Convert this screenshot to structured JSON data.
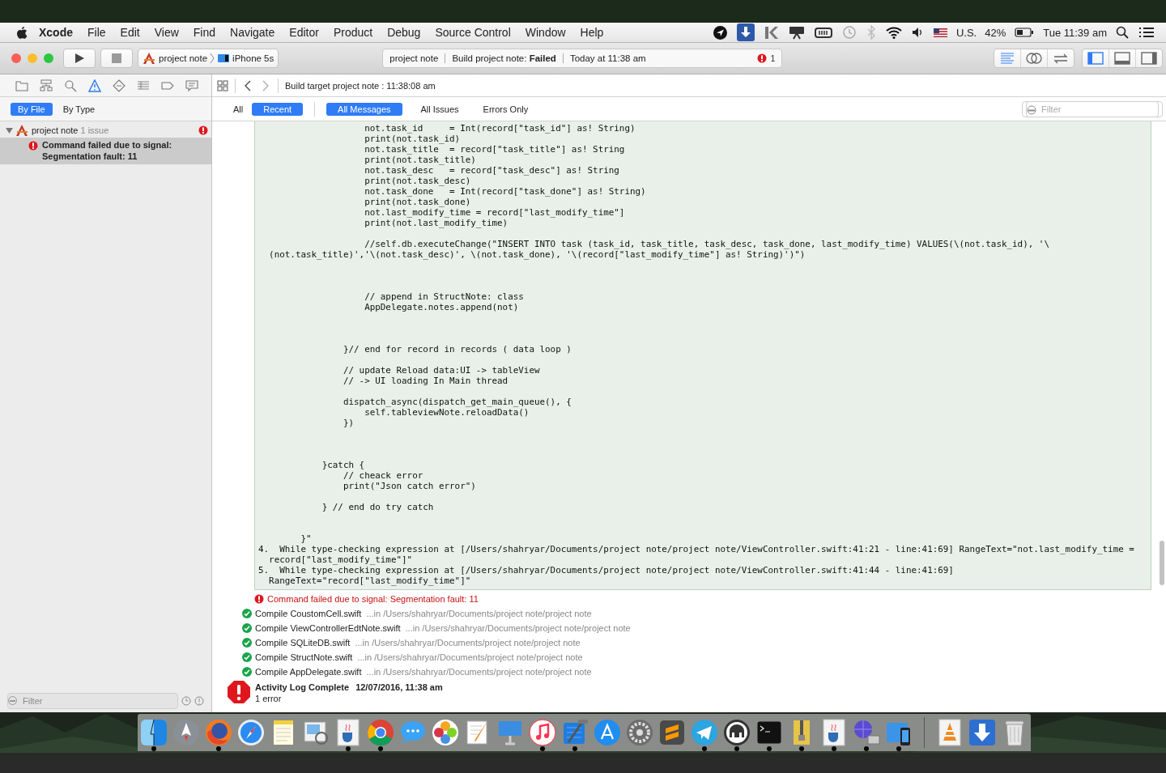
{
  "menu_bar": {
    "app_name": "Xcode",
    "items": [
      "File",
      "Edit",
      "View",
      "Find",
      "Navigate",
      "Editor",
      "Product",
      "Debug",
      "Source Control",
      "Window",
      "Help"
    ],
    "input_source": "U.S.",
    "battery": "42%",
    "clock": "Tue 11:39 am"
  },
  "toolbar": {
    "scheme": {
      "project": "project note",
      "device": "iPhone 5s"
    },
    "activity": {
      "project": "project note",
      "status": "Build project note: **Failed**",
      "time": "Today at 11:38 am",
      "error_count": "1"
    },
    "editor_modes": [
      {
        "kind": "standard",
        "selected": true
      },
      {
        "kind": "assistant",
        "selected": false
      },
      {
        "kind": "version",
        "selected": false
      }
    ],
    "panels": [
      {
        "kind": "navigator",
        "selected": true
      },
      {
        "kind": "debug",
        "selected": false
      },
      {
        "kind": "utilities",
        "selected": false
      }
    ]
  },
  "navigator": {
    "tabs": [
      {
        "kind": "folder",
        "selected": false
      },
      {
        "kind": "hierarchy",
        "selected": false
      },
      {
        "kind": "search",
        "selected": false
      },
      {
        "kind": "issue",
        "selected": true
      },
      {
        "kind": "test",
        "selected": false
      },
      {
        "kind": "debug",
        "selected": false
      },
      {
        "kind": "breakpoint",
        "selected": false
      },
      {
        "kind": "report",
        "selected": false
      }
    ],
    "scope_tabs": [
      {
        "label": "By File",
        "selected": true
      },
      {
        "label": "By Type",
        "selected": false
      }
    ],
    "tree": [
      {
        "label": "project note",
        "count": "1 issue",
        "error": true,
        "expanded": true,
        "children": [
          {
            "label": "Command failed due to signal: Segmentation fault: 11",
            "error": true,
            "selected": true
          }
        ]
      }
    ],
    "filter": {
      "placeholder": "Filter"
    }
  },
  "log": {
    "breadcrumb": "Build target project note : 11:38:08 am",
    "scopes": [
      {
        "label": "All",
        "selected": false
      },
      {
        "label": "Recent",
        "selected": true
      }
    ],
    "filters": [
      {
        "label": "All Messages",
        "selected": true
      },
      {
        "label": "All Issues",
        "selected": false
      },
      {
        "label": "Errors Only",
        "selected": false
      }
    ],
    "filter_placeholder": "Filter",
    "code": "                    not.task_id     = Int(record[\"task_id\"] as! String)\n                    print(not.task_id)\n                    not.task_title  = record[\"task_title\"] as! String\n                    print(not.task_title)\n                    not.task_desc   = record[\"task_desc\"] as! String\n                    print(not.task_desc)\n                    not.task_done   = Int(record[\"task_done\"] as! String)\n                    print(not.task_done)\n                    not.last_modify_time = record[\"last_modify_time\"]\n                    print(not.last_modify_time)\n\n                    //self.db.executeChange(\"INSERT INTO task (task_id, task_title, task_desc, task_done, last_modify_time) VALUES(\\(not.task_id), '\\\n  (not.task_title)','\\(not.task_desc)', \\(not.task_done), '\\(record[\"last_modify_time\"] as! String)')\")\n\n\n\n                    // append in StructNote: class\n                    AppDelegate.notes.append(not)\n\n\n\n                }// end for record in records ( data loop )\n\n                // update Reload data:UI -> tableView\n                // -> UI loading In Main thread\n\n                dispatch_async(dispatch_get_main_queue(), {\n                    self.tableviewNote.reloadData()\n                })\n\n\n\n            }catch {\n                // cheack error\n                print(\"Json catch error\")\n\n            } // end do try catch\n\n\n        }\"\n4.  While type-checking expression at [/Users/shahryar/Documents/project note/project note/ViewController.swift:41:21 - line:41:69] RangeText=\"not.last_modify_time =\n  record[\"last_modify_time\"]\"\n5.  While type-checking expression at [/Users/shahryar/Documents/project note/project note/ViewController.swift:41:44 - line:41:69]\n  RangeText=\"record[\"last_modify_time\"]\"",
    "entries": [
      {
        "kind": "error",
        "title": "Command failed due to signal: Segmentation fault: 11"
      },
      {
        "kind": "success",
        "title": "Compile CoustomCell.swift",
        "detail": "...in /Users/shahryar/Documents/project note/project note"
      },
      {
        "kind": "success",
        "title": "Compile ViewControllerEdtNote.swift",
        "detail": "...in /Users/shahryar/Documents/project note/project note"
      },
      {
        "kind": "success",
        "title": "Compile SQLiteDB.swift",
        "detail": "...in /Users/shahryar/Documents/project note/project note"
      },
      {
        "kind": "success",
        "title": "Compile StructNote.swift",
        "detail": "...in /Users/shahryar/Documents/project note/project note"
      },
      {
        "kind": "success",
        "title": "Compile AppDelegate.swift",
        "detail": "...in /Users/shahryar/Documents/project note/project note"
      }
    ],
    "summary": {
      "title": "Activity Log Complete",
      "date": "12/07/2016, 11:38 am",
      "detail": "1 error"
    }
  },
  "dock": {
    "items": [
      {
        "kind": "finder",
        "running": true
      },
      {
        "kind": "rocket",
        "running": false
      },
      {
        "kind": "fox",
        "running": true
      },
      {
        "kind": "compass",
        "running": false
      },
      {
        "kind": "notepad",
        "running": false
      },
      {
        "kind": "viewer",
        "running": false
      },
      {
        "kind": "cup",
        "running": true
      },
      {
        "kind": "wheel",
        "running": true
      },
      {
        "kind": "bubble",
        "running": false
      },
      {
        "kind": "flower",
        "running": false
      },
      {
        "kind": "pen",
        "running": false
      },
      {
        "kind": "podium",
        "running": false
      },
      {
        "kind": "music",
        "running": true
      },
      {
        "kind": "hammer",
        "running": true
      },
      {
        "kind": "store",
        "running": false
      },
      {
        "kind": "gear",
        "running": false
      },
      {
        "kind": "sublime",
        "running": false
      },
      {
        "kind": "plane",
        "running": true
      },
      {
        "kind": "elephant",
        "running": true
      },
      {
        "kind": "terminal",
        "running": true
      },
      {
        "kind": "archive",
        "running": true
      },
      {
        "kind": "cup",
        "running": true
      },
      {
        "kind": "network",
        "running": true
      },
      {
        "kind": "phone",
        "running": true
      },
      {
        "kind": "separator"
      },
      {
        "kind": "cone",
        "running": false
      },
      {
        "kind": "download",
        "running": false
      },
      {
        "kind": "trash",
        "running": false
      }
    ]
  }
}
